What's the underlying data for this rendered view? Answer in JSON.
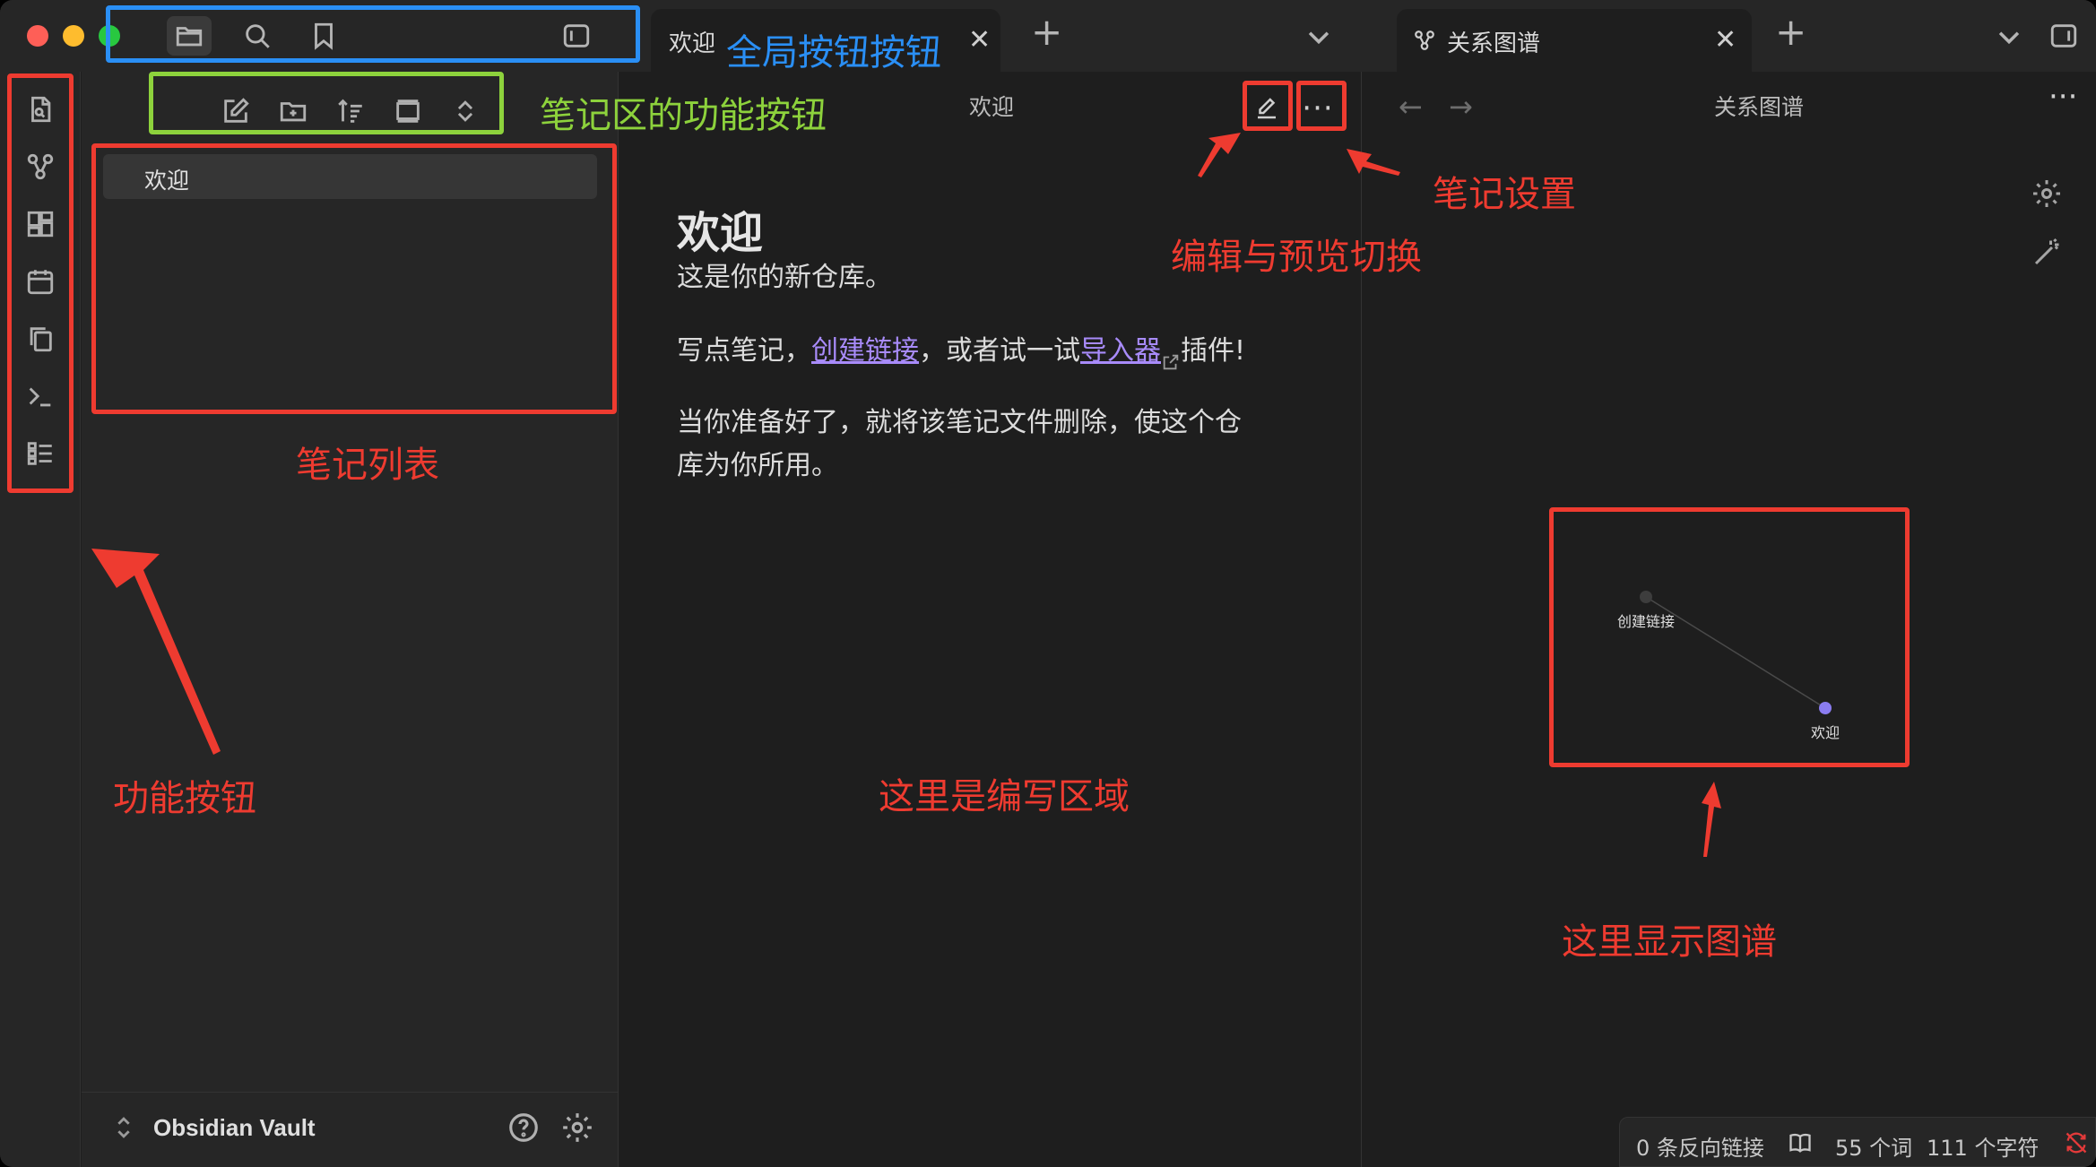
{
  "window": {
    "tabs": [
      {
        "label": "欢迎",
        "close": "✕"
      },
      {
        "label": "关系图谱",
        "close": "✕"
      }
    ],
    "new_tab": "+",
    "icons": [
      "folder-icon",
      "search-icon",
      "bookmark-icon",
      "sidebar-toggle-icon"
    ]
  },
  "file_panel": {
    "notes": [
      {
        "label": "欢迎"
      }
    ],
    "vault_name": "Obsidian Vault"
  },
  "editor": {
    "header_title": "欢迎",
    "heading": "欢迎",
    "para1": "这是你的新仓库。",
    "para2_a": "写点笔记，",
    "para2_link": "创建链接",
    "para2_b": "，或者试一试",
    "para2_ext": "导入器",
    "para2_c": "插件!",
    "para3_line1": "当你准备好了，就将该笔记文件删除，使这个仓",
    "para3_line2": "库为你所用。",
    "more": "···"
  },
  "graph": {
    "title": "关系图谱",
    "back": "←",
    "forward": "→",
    "more": "···",
    "nodes": [
      {
        "label": "创建链接",
        "color": "#3d3d3d"
      },
      {
        "label": "欢迎",
        "color": "#8a7cf0"
      }
    ]
  },
  "status": {
    "backlinks": "0 条反向链接",
    "words": "55 个词",
    "chars": "111 个字符"
  },
  "annotations": {
    "global_buttons": "全局按钮按钮",
    "note_area_buttons": "笔记区的功能按钮",
    "note_list": "笔记列表",
    "function_buttons": "功能按钮",
    "writing_area": "这里是编写区域",
    "note_settings": "笔记设置",
    "edit_preview": "编辑与预览切换",
    "graph_here": "这里显示图谱"
  },
  "colors": {
    "annotation_red": "#ee3b30",
    "annotation_blue": "#2a8ff5",
    "annotation_green": "#8dd23c",
    "accent": "#a88bfa"
  }
}
